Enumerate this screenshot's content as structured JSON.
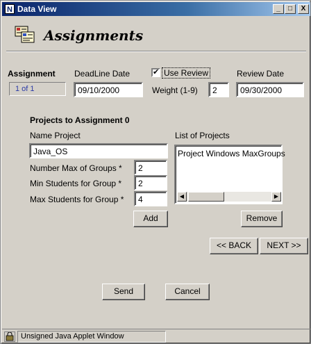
{
  "window": {
    "title": "Data View",
    "icon": "java-n-icon",
    "controls": {
      "minimize": "_",
      "maximize": "□",
      "close": "X"
    }
  },
  "header": {
    "title": "Assignments",
    "icon": "assignment-forms-icon"
  },
  "assignment": {
    "label": "Assignment",
    "counter": "1  of 1",
    "deadline_label": "DeadLine Date",
    "deadline_value": "09/10/2000",
    "use_review_label": "Use Review",
    "use_review_checked": "✔",
    "weight_label": "Weight (1-9)",
    "weight_value": "2",
    "review_date_label": "Review Date",
    "review_date_value": "09/30/2000"
  },
  "projects": {
    "section_title": "Projects to Assignment 0",
    "name_label": "Name Project",
    "name_value": "Java_OS",
    "max_groups_label": "Number Max of Groups *",
    "max_groups_value": "2",
    "min_students_label": "Min Students for Group *",
    "min_students_value": "2",
    "max_students_label": "Max Students for Group *",
    "max_students_value": "4",
    "add_label": "Add",
    "list_label": "List of Projects",
    "list_items": [
      "Project Windows MaxGroups"
    ],
    "remove_label": "Remove"
  },
  "nav": {
    "back_label": "<< BACK",
    "next_label": "NEXT >>"
  },
  "actions": {
    "send_label": "Send",
    "cancel_label": "Cancel"
  },
  "statusbar": {
    "text": "Unsigned Java Applet Window",
    "icon": "applet-key-icon"
  }
}
